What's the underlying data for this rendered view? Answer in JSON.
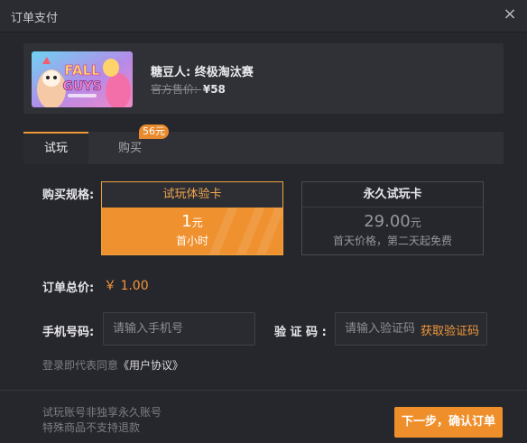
{
  "window": {
    "title": "订单支付",
    "close_icon": "close-icon"
  },
  "product": {
    "name": "糖豆人: 终极淘汰赛",
    "original_price_label": "官方售价: ",
    "original_price": "¥58",
    "cover_logo_line1": "FALL",
    "cover_logo_line2": "GUYS"
  },
  "tabs": {
    "trial": "试玩",
    "buy": "购买",
    "buy_badge": "56元"
  },
  "spec": {
    "label": "购买规格:",
    "options": [
      {
        "title": "试玩体验卡",
        "price": "1",
        "unit": "元",
        "desc": "首小时",
        "selected": true
      },
      {
        "title": "永久试玩卡",
        "price": "29.00",
        "unit": "元",
        "desc": "首天价格，第二天起免费",
        "selected": false
      }
    ]
  },
  "total": {
    "label": "订单总价:",
    "value": "￥ 1.00"
  },
  "phone": {
    "label": "手机号码:",
    "placeholder": "请输入手机号"
  },
  "code": {
    "label": "验 证 码 :",
    "placeholder": "请输入验证码",
    "button": "获取验证码"
  },
  "agreement": {
    "prefix": "登录即代表同意",
    "link": "《用户协议》"
  },
  "notes": [
    "试玩账号非独享永久账号",
    "特殊商品不支持退款"
  ],
  "next_button": "下一步，确认订单",
  "colors": {
    "accent": "#ef912f",
    "background": "#26272c"
  }
}
